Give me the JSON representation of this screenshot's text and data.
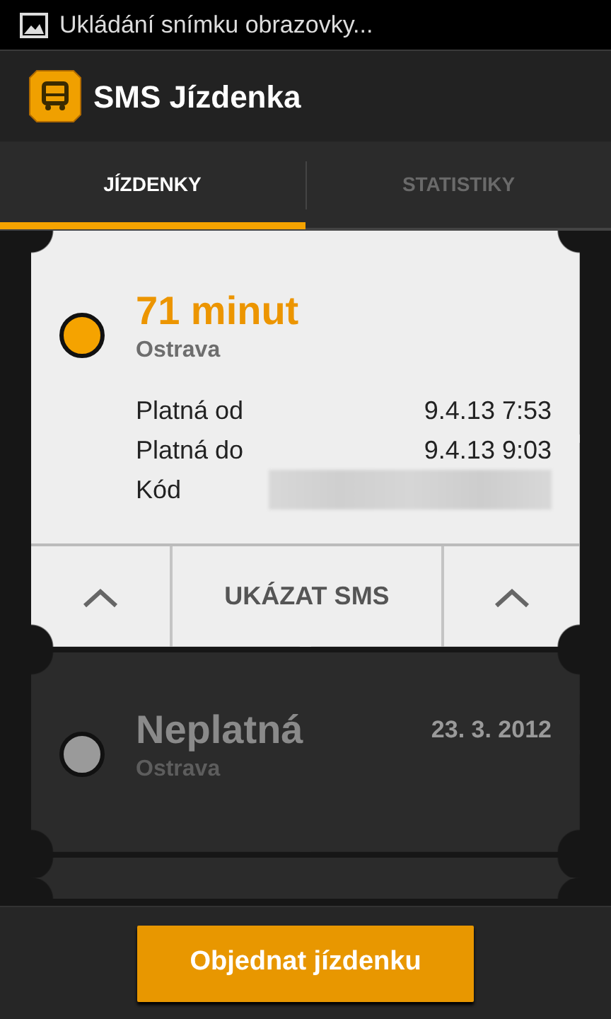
{
  "status_bar": {
    "notification": "Ukládání snímku obrazovky..."
  },
  "app_bar": {
    "title": "SMS Jízdenka"
  },
  "tabs": [
    {
      "label": "JÍZDENKY",
      "selected": true
    },
    {
      "label": "STATISTIKY",
      "selected": false
    }
  ],
  "tickets": [
    {
      "title": "71 minut",
      "city": "Ostrava",
      "valid": true,
      "expanded": true,
      "details": [
        {
          "label": "Platná od",
          "value": "9.4.13 7:53"
        },
        {
          "label": "Platná do",
          "value": "9.4.13 9:03"
        },
        {
          "label": "Kód",
          "redacted": true
        }
      ],
      "action": "UKÁZAT SMS"
    },
    {
      "title": "Neplatná",
      "city": "Ostrava",
      "valid": false,
      "expanded": false,
      "date": "23. 3. 2012"
    }
  ],
  "order_button": "Objednat jízdenku"
}
